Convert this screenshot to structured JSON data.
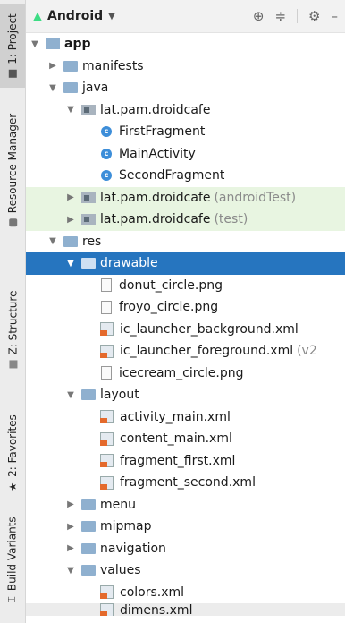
{
  "toolstrip": {
    "tabs": [
      {
        "label": "1: Project",
        "active": true
      },
      {
        "label": "Resource Manager"
      },
      {
        "label": "Z: Structure"
      },
      {
        "label": "2: Favorites"
      },
      {
        "label": "Build Variants"
      }
    ]
  },
  "header": {
    "selector_label": "Android",
    "icons": [
      "target-icon",
      "collapse-icon",
      "gear-icon",
      "minimize-icon"
    ]
  },
  "tree": {
    "app": "app",
    "manifests": "manifests",
    "java": "java",
    "pkg1": "lat.pam.droidcafe",
    "first_fragment": "FirstFragment",
    "main_activity": "MainActivity",
    "second_fragment": "SecondFragment",
    "pkg2": "lat.pam.droidcafe",
    "pkg2_suffix": "(androidTest)",
    "pkg3": "lat.pam.droidcafe",
    "pkg3_suffix": "(test)",
    "res": "res",
    "drawable": "drawable",
    "donut": "donut_circle.png",
    "froyo": "froyo_circle.png",
    "ic_bg": "ic_launcher_background.xml",
    "ic_fg": "ic_launcher_foreground.xml",
    "ic_fg_suffix": "(v2",
    "icecream": "icecream_circle.png",
    "layout": "layout",
    "activity_main": "activity_main.xml",
    "content_main": "content_main.xml",
    "fragment_first": "fragment_first.xml",
    "fragment_second": "fragment_second.xml",
    "menu": "menu",
    "mipmap": "mipmap",
    "navigation": "navigation",
    "values": "values",
    "colors": "colors.xml",
    "partial_last": "dimens.xml"
  }
}
